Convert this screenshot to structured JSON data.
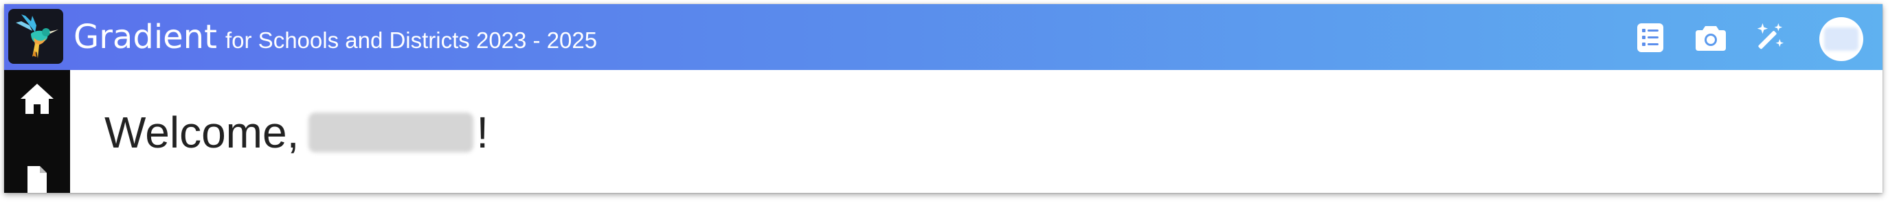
{
  "app": {
    "name": "Gradient",
    "subtitle": "for Schools and Districts 2023 - 2025"
  },
  "colors": {
    "header_gradient_start": "#5a71ec",
    "header_gradient_end": "#5fb1f0",
    "sidebar_bg": "#0c0c0c",
    "logo_bg": "#14161f"
  },
  "header_icons": [
    {
      "name": "list-icon"
    },
    {
      "name": "camera-icon"
    },
    {
      "name": "magic-wand-icon"
    },
    {
      "name": "avatar"
    }
  ],
  "sidebar": {
    "items": [
      {
        "name": "home-icon"
      },
      {
        "name": "document-icon"
      }
    ]
  },
  "main": {
    "welcome_prefix": "Welcome,",
    "welcome_suffix": "!"
  }
}
